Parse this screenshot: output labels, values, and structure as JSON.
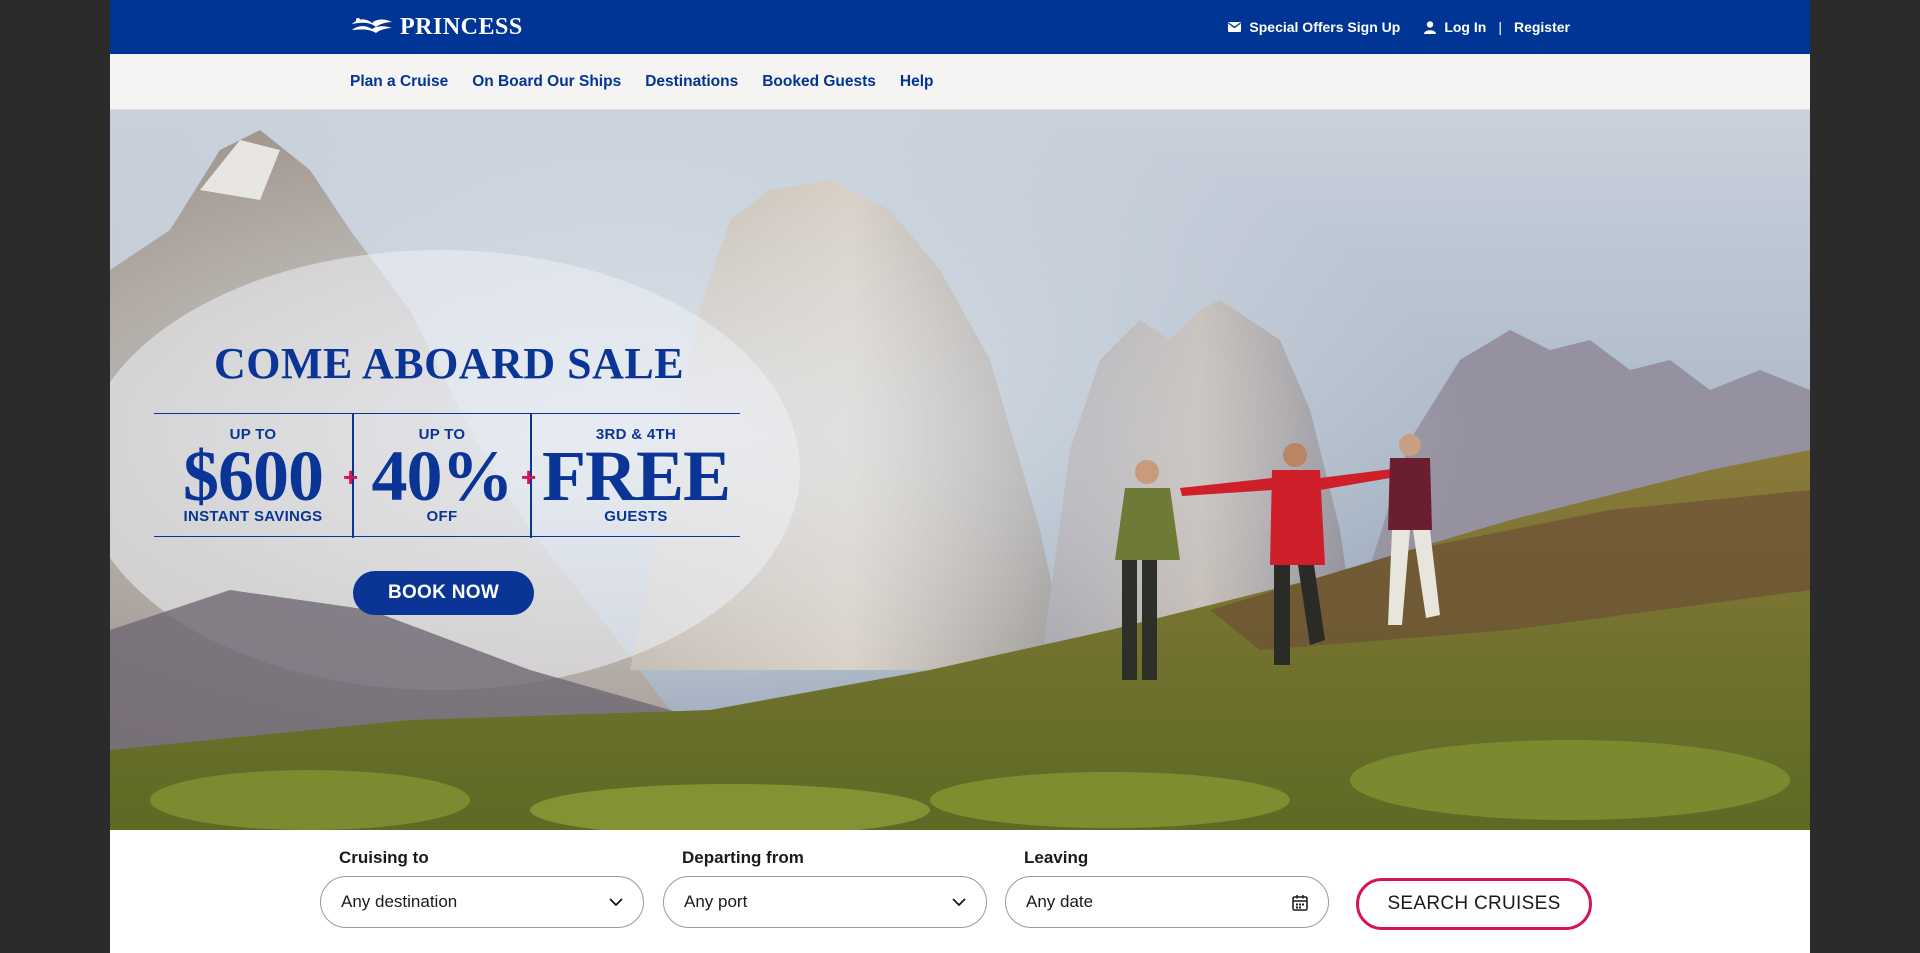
{
  "brand": {
    "name": "PRINCESS",
    "color": "#003595"
  },
  "utility": {
    "offers": "Special Offers Sign Up",
    "login": "Log In",
    "separator": "|",
    "register": "Register"
  },
  "nav": {
    "items": [
      "Plan a Cruise",
      "On Board Our Ships",
      "Destinations",
      "Booked Guests",
      "Help"
    ]
  },
  "promo": {
    "title": "COME ABOARD SALE",
    "offers": [
      {
        "top": "UP TO",
        "big": "$600",
        "bottom": "INSTANT SAVINGS"
      },
      {
        "top": "UP TO",
        "big": "40%",
        "bottom": "OFF"
      },
      {
        "top": "3RD & 4TH",
        "big": "FREE",
        "bottom": "GUESTS"
      }
    ],
    "plus": "+",
    "cta": "BOOK NOW",
    "accent": "#d6135b"
  },
  "search": {
    "cruising_to": {
      "label": "Cruising to",
      "value": "Any destination"
    },
    "departing_from": {
      "label": "Departing from",
      "value": "Any port"
    },
    "leaving": {
      "label": "Leaving",
      "value": "Any date"
    },
    "button": "SEARCH CRUISES"
  }
}
